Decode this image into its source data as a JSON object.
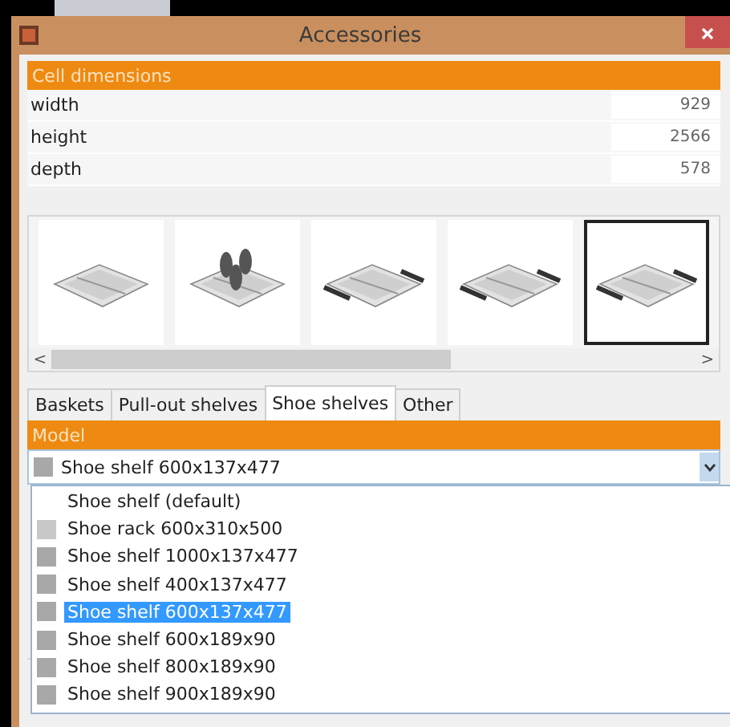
{
  "window": {
    "title": "Accessories"
  },
  "cell_dimensions": {
    "title": "Cell dimensions",
    "rows": [
      {
        "label": "width",
        "value": "929"
      },
      {
        "label": "height",
        "value": "2566"
      },
      {
        "label": "depth",
        "value": "578"
      }
    ]
  },
  "gallery": {
    "items": [
      {
        "kind": "picture",
        "selected": false
      },
      {
        "kind": "picture",
        "selected": false
      },
      {
        "kind": "picture",
        "selected": false
      },
      {
        "kind": "picture",
        "selected": false
      },
      {
        "kind": "picture",
        "selected": true
      }
    ],
    "scroll_left": "<",
    "scroll_right": ">"
  },
  "tabs": [
    {
      "label": "Baskets",
      "selected": false
    },
    {
      "label": "Pull-out shelves",
      "selected": false
    },
    {
      "label": "Shoe shelves",
      "selected": true
    },
    {
      "label": "Other",
      "selected": false
    }
  ],
  "model": {
    "title": "Model",
    "value": "Shoe shelf 600x137x477",
    "expanded": true,
    "options": [
      {
        "label": "Shoe shelf (default)",
        "selected": false
      },
      {
        "label": "Shoe rack 600x310x500",
        "color": "#c8c8c8",
        "selected": false
      },
      {
        "label": "Shoe shelf 1000x137x477",
        "color": "#a8a8a8",
        "selected": false
      },
      {
        "label": "Shoe shelf 400x137x477",
        "color": "#a8a8a8",
        "selected": false
      },
      {
        "label": "Shoe shelf 600x137x477",
        "color": "#a8a8a8",
        "selected": true
      },
      {
        "label": "Shoe shelf 600x189x90",
        "color": "#a8a8a8",
        "selected": false
      },
      {
        "label": "Shoe shelf 800x189x90",
        "color": "#a8a8a8",
        "selected": false
      },
      {
        "label": "Shoe shelf 900x189x90",
        "color": "#a8a8a8",
        "selected": false
      }
    ]
  }
}
